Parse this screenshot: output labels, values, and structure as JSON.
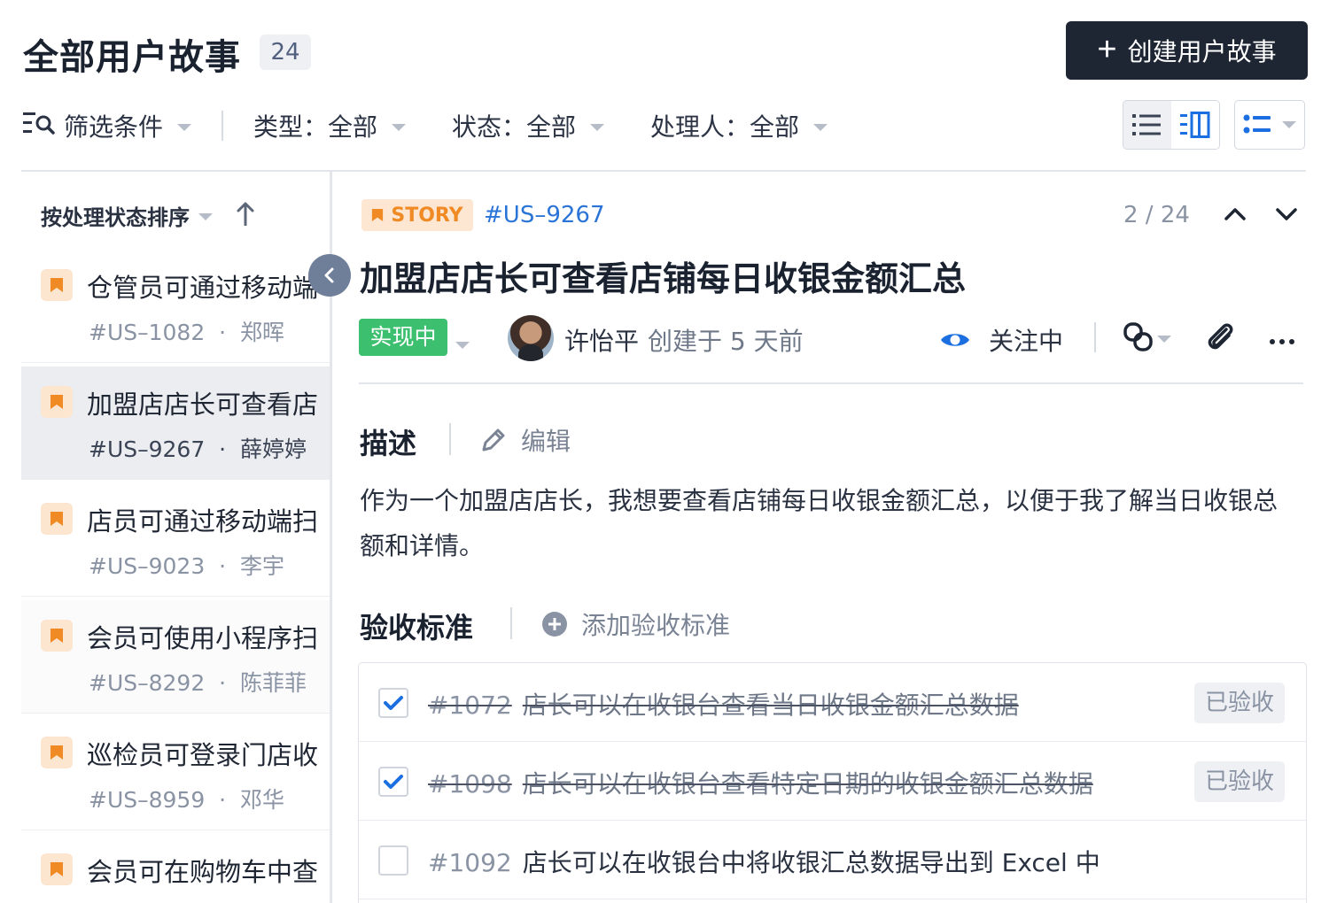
{
  "header": {
    "title": "全部用户故事",
    "count": "24",
    "create_label": "创建用户故事"
  },
  "filters": {
    "filter_label": "筛选条件",
    "type": "类型：全部",
    "status": "状态：全部",
    "assignee": "处理人：全部"
  },
  "list": {
    "sort_label": "按处理状态排序",
    "items": [
      {
        "title": "仓管员可通过移动端",
        "id": "#US–1082",
        "owner": "郑晖"
      },
      {
        "title": "加盟店店长可查看店",
        "id": "#US–9267",
        "owner": "薛婷婷"
      },
      {
        "title": "店员可通过移动端扫",
        "id": "#US–9023",
        "owner": "李宇"
      },
      {
        "title": "会员可使用小程序扫",
        "id": "#US–8292",
        "owner": "陈菲菲"
      },
      {
        "title": "巡检员可登录门店收",
        "id": "#US–8959",
        "owner": "邓华"
      },
      {
        "title": "会员可在购物车中查",
        "id": "",
        "owner": ""
      }
    ]
  },
  "detail": {
    "tag": "STORY",
    "id": "#US–9267",
    "pager": "2 / 24",
    "title": "加盟店店长可查看店铺每日收银金额汇总",
    "status": "实现中",
    "creator": "许怡平",
    "created": "创建于 5 天前",
    "watch_label": "关注中",
    "description_title": "描述",
    "edit_label": "编辑",
    "description": "作为一个加盟店店长，我想要查看店铺每日收银金额汇总，以便于我了解当日收银总额和详情。",
    "criteria_title": "验收标准",
    "add_criteria_label": "添加验收标准",
    "criteria": [
      {
        "id": "#1072",
        "text": "店长可以在收银台查看当日收银金额汇总数据",
        "checked": true,
        "badge": "已验收"
      },
      {
        "id": "#1098",
        "text": "店长可以在收银台查看特定日期的收银金额汇总数据",
        "checked": true,
        "badge": "已验收"
      },
      {
        "id": "#1092",
        "text": "店长可以在收银台中将收银汇总数据导出到 Excel 中",
        "checked": false,
        "badge": ""
      }
    ]
  },
  "colors": {
    "primary_dark": "#1e2634",
    "link_blue": "#2a74d8",
    "status_green": "#3cbf6e",
    "story_orange": "#f08a24",
    "watch_blue": "#1b6fe0"
  },
  "icons": {
    "filter": "filter-search-icon",
    "sort": "arrow-up-icon",
    "link": "link-icon",
    "attach": "paperclip-icon",
    "more": "more-icon"
  }
}
